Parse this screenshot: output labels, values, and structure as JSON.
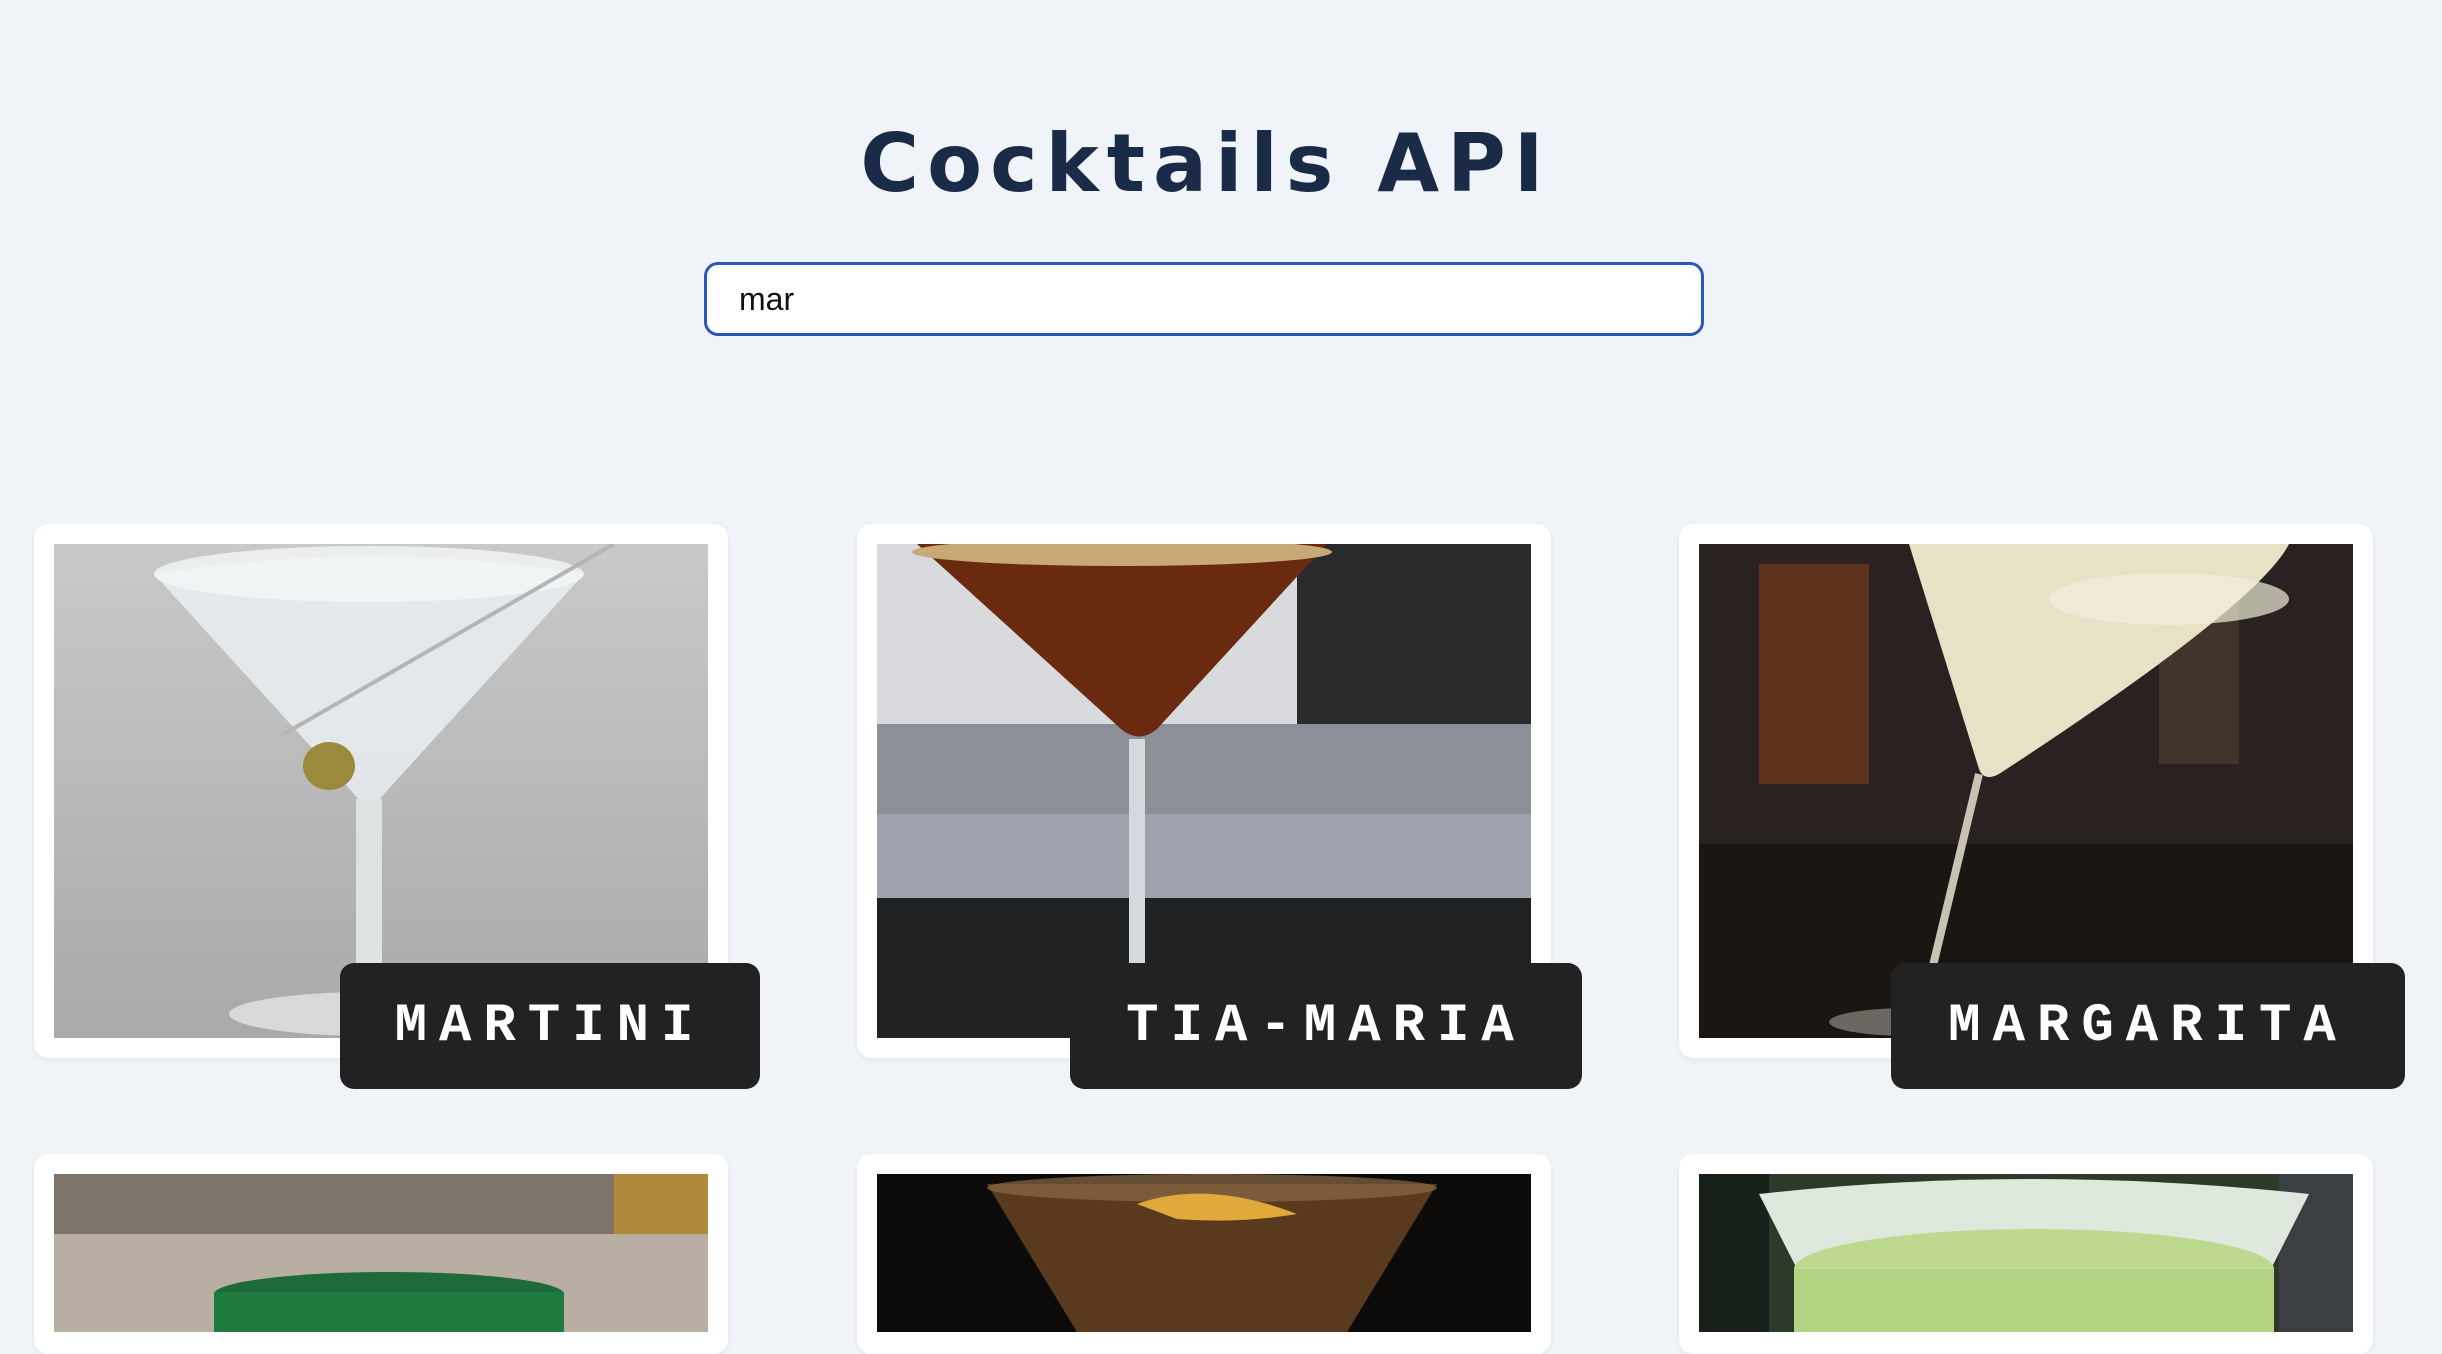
{
  "header": {
    "title": "Cocktails API"
  },
  "search": {
    "value": "mar"
  },
  "cards": [
    {
      "name": "MARTINI"
    },
    {
      "name": "TIA-MARIA"
    },
    {
      "name": "MARGARITA"
    }
  ]
}
